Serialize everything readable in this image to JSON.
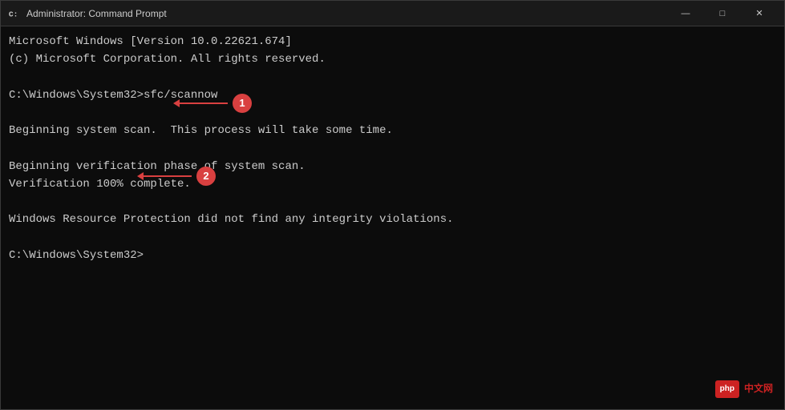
{
  "window": {
    "title": "Administrator: Command Prompt",
    "icon": "cmd-icon"
  },
  "title_controls": {
    "minimize": "—",
    "maximize": "□",
    "close": "✕"
  },
  "console": {
    "lines": [
      "Microsoft Windows [Version 10.0.22621.674]",
      "(c) Microsoft Corporation. All rights reserved.",
      "",
      "C:\\Windows\\System32>sfc/scannow",
      "",
      "Beginning system scan.  This process will take some time.",
      "",
      "Beginning verification phase of system scan.",
      "Verification 100% complete.",
      "",
      "Windows Resource Protection did not find any integrity violations.",
      "",
      "C:\\Windows\\System32>"
    ]
  },
  "annotations": [
    {
      "number": "1",
      "label": "annotation-1"
    },
    {
      "number": "2",
      "label": "annotation-2"
    }
  ],
  "watermark": {
    "logo_text": "php",
    "site_text": "中文网"
  }
}
